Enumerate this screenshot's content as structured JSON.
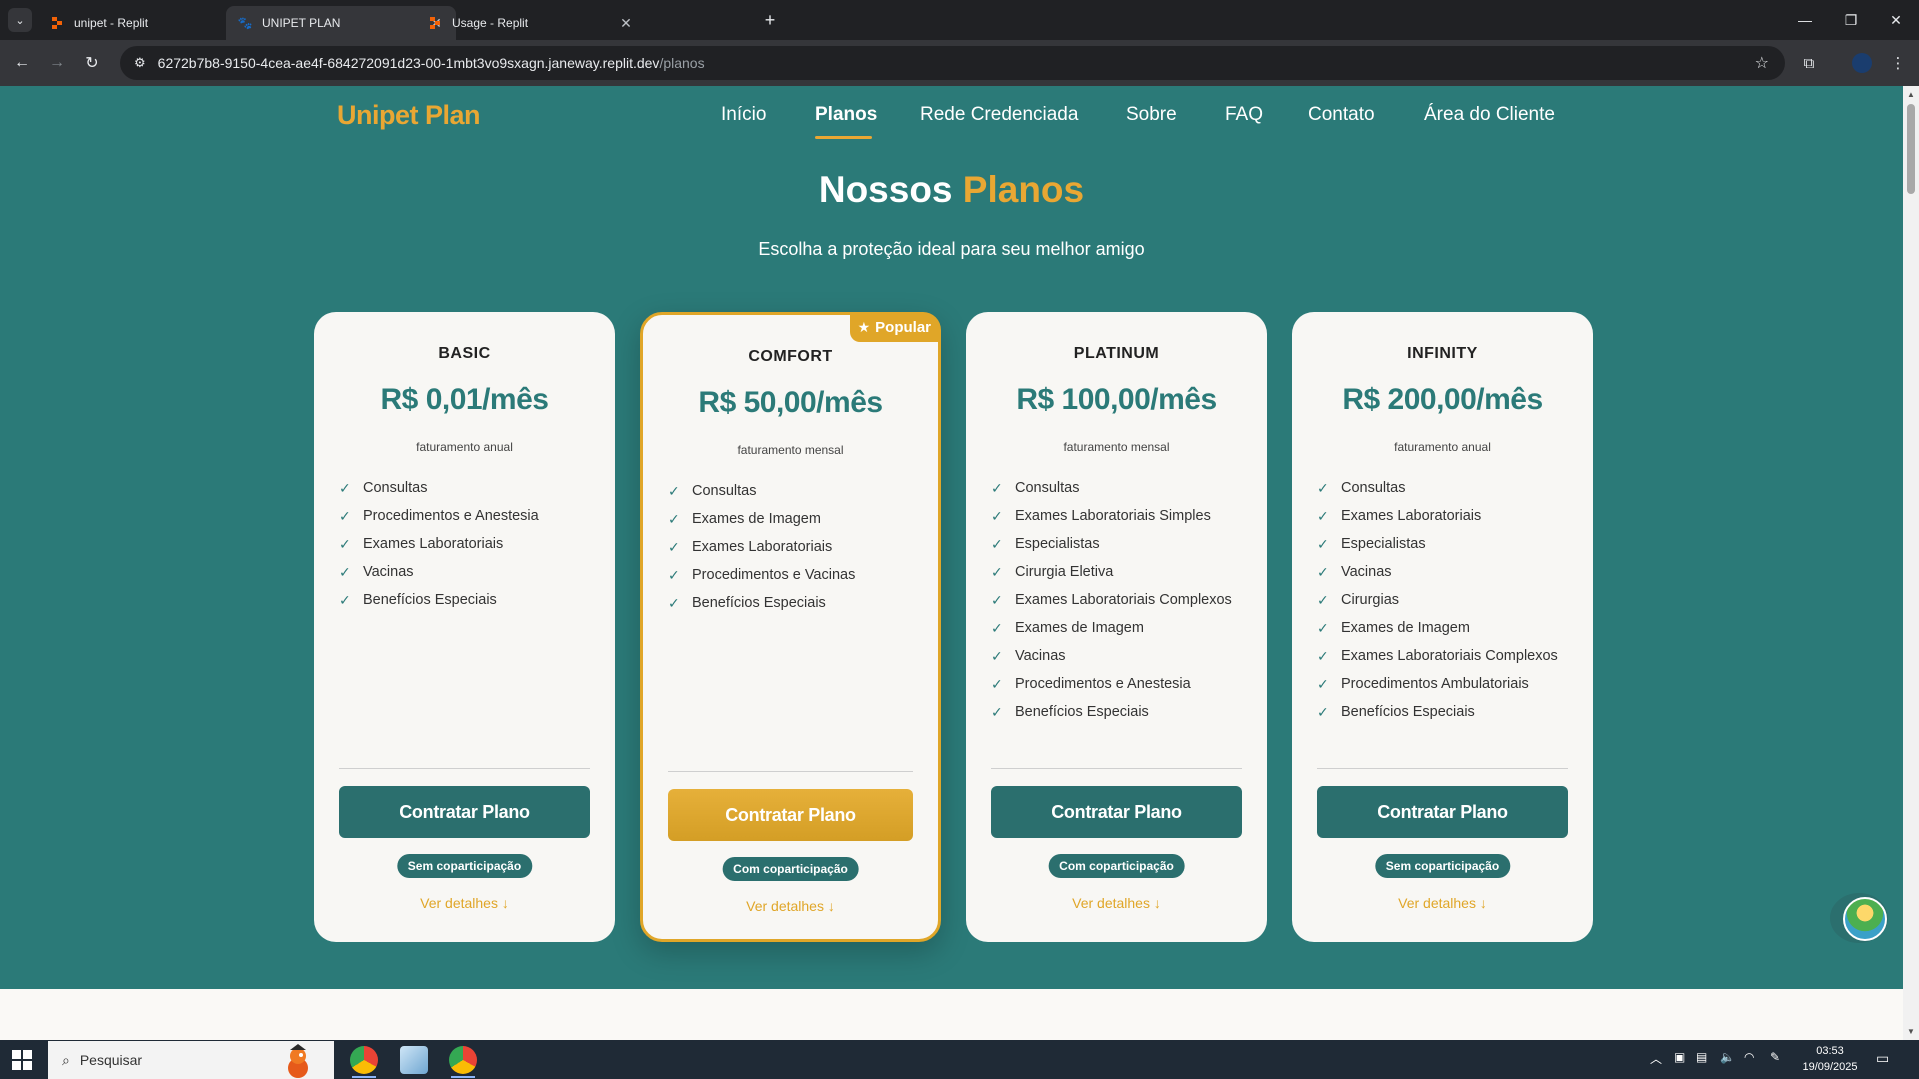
{
  "browser": {
    "tabs": [
      {
        "title": "unipet - Replit",
        "favicon": "replit-icon"
      },
      {
        "title": "UNIPET PLAN",
        "favicon": "paw-icon",
        "active": true
      },
      {
        "title": "Usage - Replit",
        "favicon": "replit-icon"
      }
    ],
    "url_host": "6272b7b8-9150-4cea-ae4f-684272091d23-00-1mbt3vo9sxagn.janeway.replit.dev",
    "url_path": "/planos"
  },
  "site": {
    "logo": "Unipet Plan",
    "nav": [
      {
        "label": "Início"
      },
      {
        "label": "Planos",
        "active": true
      },
      {
        "label": "Rede Credenciada"
      },
      {
        "label": "Sobre"
      },
      {
        "label": "FAQ"
      },
      {
        "label": "Contato"
      },
      {
        "label": "Área do Cliente"
      }
    ],
    "hero": {
      "title_main": "Nossos",
      "title_accent": "Planos",
      "subtitle": "Escolha a proteção ideal para seu melhor amigo"
    }
  },
  "plans": [
    {
      "name": "BASIC",
      "price": "R$ 0,01/mês",
      "billing": "faturamento anual",
      "features": [
        "Consultas",
        "Procedimentos e Anestesia",
        "Exames Laboratoriais",
        "Vacinas",
        "Benefícios Especiais"
      ],
      "cta": "Contratar Plano",
      "copart": "Sem coparticipação",
      "details": "Ver detalhes ↓"
    },
    {
      "name": "COMFORT",
      "price": "R$ 50,00/mês",
      "billing": "faturamento mensal",
      "badge": "Popular",
      "features": [
        "Consultas",
        "Exames de Imagem",
        "Exames Laboratoriais",
        "Procedimentos e Vacinas",
        "Benefícios Especiais"
      ],
      "cta": "Contratar Plano",
      "copart": "Com coparticipação",
      "details": "Ver detalhes ↓"
    },
    {
      "name": "PLATINUM",
      "price": "R$ 100,00/mês",
      "billing": "faturamento mensal",
      "features": [
        "Consultas",
        "Exames Laboratoriais Simples",
        "Especialistas",
        "Cirurgia Eletiva",
        "Exames Laboratoriais Complexos",
        "Exames de Imagem",
        "Vacinas",
        "Procedimentos e Anestesia",
        "Benefícios Especiais"
      ],
      "cta": "Contratar Plano",
      "copart": "Com coparticipação",
      "details": "Ver detalhes ↓"
    },
    {
      "name": "INFINITY",
      "price": "R$ 200,00/mês",
      "billing": "faturamento anual",
      "features": [
        "Consultas",
        "Exames Laboratoriais",
        "Especialistas",
        "Vacinas",
        "Cirurgias",
        "Exames de Imagem",
        "Exames Laboratoriais Complexos",
        "Procedimentos Ambulatoriais",
        "Benefícios Especiais"
      ],
      "cta": "Contratar Plano",
      "copart": "Sem coparticipação",
      "details": "Ver detalhes ↓"
    }
  ],
  "taskbar": {
    "search_placeholder": "Pesquisar",
    "time": "03:53",
    "date": "19/09/2025"
  },
  "colors": {
    "teal": "#2b7a78",
    "gold": "#e0a628",
    "card_bg": "#f8f7f4"
  }
}
